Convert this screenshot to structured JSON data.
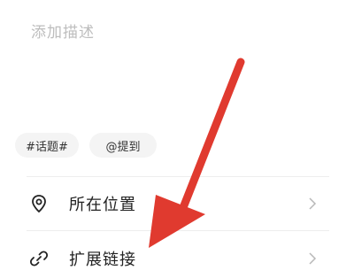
{
  "description": {
    "placeholder": "添加描述"
  },
  "tags": [
    {
      "label": "#话题#"
    },
    {
      "label": "@提到"
    }
  ],
  "rows": [
    {
      "label": "所在位置",
      "icon": "location-pin-icon"
    },
    {
      "label": "扩展链接",
      "icon": "link-icon"
    }
  ],
  "colors": {
    "annotation_arrow": "#e03a2f",
    "placeholder_text": "#bdbdbd"
  }
}
